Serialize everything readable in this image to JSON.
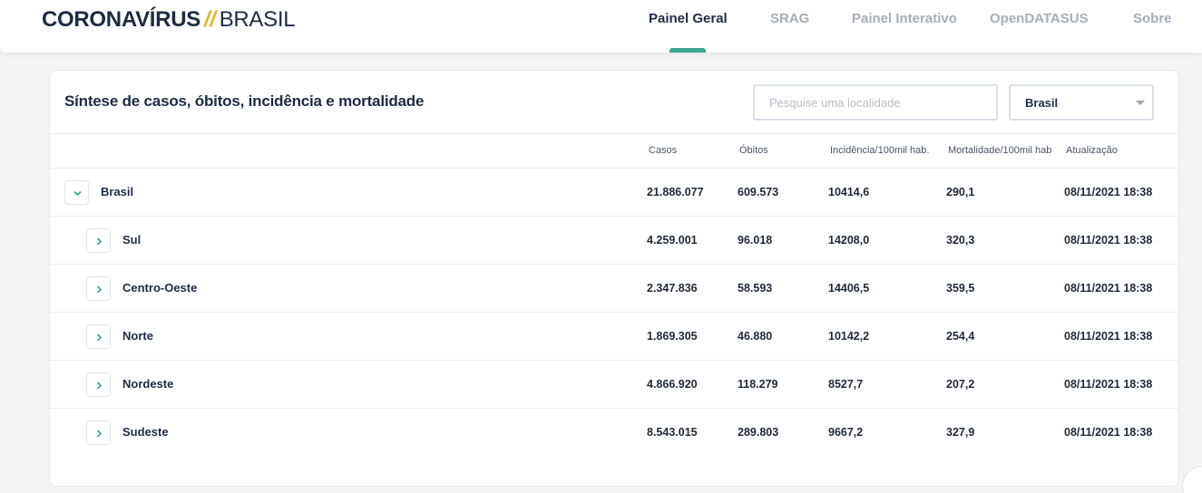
{
  "header": {
    "logo_bold": "CORONAVÍRUS",
    "logo_slash": "//",
    "logo_light": "BRASIL",
    "nav": [
      {
        "label": "Painel Geral",
        "active": true
      },
      {
        "label": "SRAG",
        "active": false
      },
      {
        "label": "Painel Interativo",
        "active": false
      },
      {
        "label": "OpenDATASUS",
        "active": false
      },
      {
        "label": "Sobre",
        "active": false
      }
    ]
  },
  "card": {
    "title": "Síntese de casos, óbitos, incidência e mortalidade",
    "search_placeholder": "Pesquise uma localidade",
    "select_value": "Brasil"
  },
  "table": {
    "columns": [
      "Casos",
      "Óbitos",
      "Incidência/100mil hab.",
      "Mortalidade/100mil hab",
      "Atualização"
    ],
    "rows": [
      {
        "name": "Brasil",
        "expanded": true,
        "level": 0,
        "casos": "21.886.077",
        "obitos": "609.573",
        "incidencia": "10414,6",
        "mortalidade": "290,1",
        "atualizacao": "08/11/2021 18:38"
      },
      {
        "name": "Sul",
        "expanded": false,
        "level": 1,
        "casos": "4.259.001",
        "obitos": "96.018",
        "incidencia": "14208,0",
        "mortalidade": "320,3",
        "atualizacao": "08/11/2021 18:38"
      },
      {
        "name": "Centro-Oeste",
        "expanded": false,
        "level": 1,
        "casos": "2.347.836",
        "obitos": "58.593",
        "incidencia": "14406,5",
        "mortalidade": "359,5",
        "atualizacao": "08/11/2021 18:38"
      },
      {
        "name": "Norte",
        "expanded": false,
        "level": 1,
        "casos": "1.869.305",
        "obitos": "46.880",
        "incidencia": "10142,2",
        "mortalidade": "254,4",
        "atualizacao": "08/11/2021 18:38"
      },
      {
        "name": "Nordeste",
        "expanded": false,
        "level": 1,
        "casos": "4.866.920",
        "obitos": "118.279",
        "incidencia": "8527,7",
        "mortalidade": "207,2",
        "atualizacao": "08/11/2021 18:38"
      },
      {
        "name": "Sudeste",
        "expanded": false,
        "level": 1,
        "casos": "8.543.015",
        "obitos": "289.803",
        "incidencia": "9667,2",
        "mortalidade": "327,9",
        "atualizacao": "08/11/2021 18:38"
      }
    ]
  },
  "colors": {
    "accent": "#3aa58c",
    "logo_slash": "#e3b52b",
    "text_dark": "#1c2b45"
  }
}
